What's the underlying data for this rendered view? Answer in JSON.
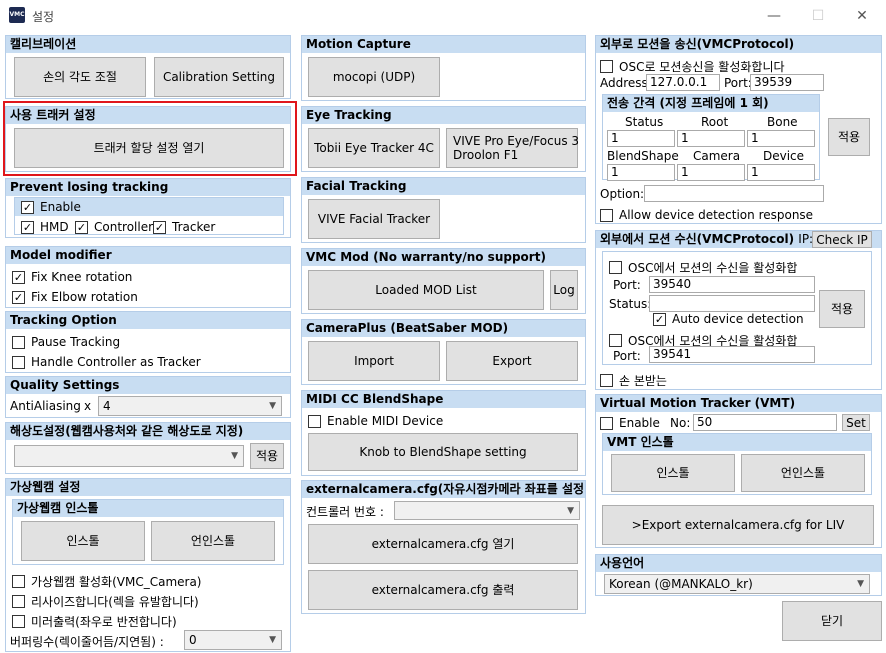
{
  "window": {
    "title": "설정",
    "icon_text": "VMC"
  },
  "calib": {
    "title": "캘리브레이션",
    "hand_btn": "손의 각도 조절",
    "calib_btn": "Calibration Setting"
  },
  "tracker": {
    "title": "사용 트래커 설정",
    "open_btn": "트래커 할당 설정 열기"
  },
  "prevent": {
    "title": "Prevent losing tracking",
    "enable": "Enable",
    "hmd": "HMD",
    "controller": "Controller",
    "tracker": "Tracker"
  },
  "model": {
    "title": "Model modifier",
    "knee": "Fix Knee rotation",
    "elbow": "Fix Elbow rotation"
  },
  "tracking_option": {
    "title": "Tracking Option",
    "pause": "Pause Tracking",
    "handle": "Handle Controller as Tracker"
  },
  "quality": {
    "title": "Quality Settings",
    "aa_label": "AntiAliasing",
    "x": "x",
    "aa_value": "4"
  },
  "resolution": {
    "title": "해상도설정(웹캠사용처와 같은 해상도로 지정)",
    "apply": "적용"
  },
  "vcam": {
    "title": "가상웹캠 설정",
    "install_title": "가상웹캠 인스톨",
    "install": "인스톨",
    "uninstall": "언인스톨",
    "enable": "가상웹캠 활성화(VMC_Camera)",
    "resize": "리사이즈합니다(렉을 유발합니다)",
    "mirror": "미러출력(좌우로 반전합니다)",
    "buffer_label": "버퍼링수(렉이줄어듬/지연됨) :",
    "buffer_value": "0"
  },
  "mocap": {
    "title": "Motion Capture",
    "mocopi": "mocopi (UDP)"
  },
  "eye": {
    "title": "Eye Tracking",
    "tobii": "Tobii Eye Tracker 4C",
    "vive_line1": "VIVE Pro Eye/Focus 3",
    "vive_line2": "Droolon F1"
  },
  "facial": {
    "title": "Facial Tracking",
    "vive": "VIVE Facial Tracker"
  },
  "vmcmod": {
    "title": "VMC Mod (No warranty/no support)",
    "loaded": "Loaded MOD List",
    "log": "Log"
  },
  "cameraplus": {
    "title": "CameraPlus (BeatSaber MOD)",
    "import": "Import",
    "export": "Export"
  },
  "midi": {
    "title": "MIDI CC BlendShape",
    "enable": "Enable MIDI Device",
    "knob": "Knob to BlendShape setting"
  },
  "extcam": {
    "title": "externalcamera.cfg(자유시점카메라 좌표를 설정)",
    "controller_label": "컨트롤러 번호 :",
    "open": "externalcamera.cfg 열기",
    "output": "externalcamera.cfg 출력"
  },
  "send": {
    "title": "외부로 모션을 송신(VMCProtocol)",
    "osc_enable": "OSC로 모션송신을 활성화합니다",
    "address_label": "Address:",
    "address": "127.0.0.1",
    "port_label": "Port:",
    "port": "39539",
    "interval_title": "전송 간격 (지정 프레임에 1 회)",
    "status": "Status",
    "root": "Root",
    "bone": "Bone",
    "status_v": "1",
    "root_v": "1",
    "bone_v": "1",
    "blendshape": "BlendShape",
    "camera": "Camera",
    "device": "Device",
    "blend_v": "1",
    "camera_v": "1",
    "device_v": "1",
    "apply": "적용",
    "option_label": "Option:",
    "allow": "Allow device detection response"
  },
  "receive": {
    "title": "외부에서 모션 수신(VMCProtocol)",
    "ip_label": "IP:",
    "check_ip": "Check IP",
    "osc1": "OSC에서 모션의 수신을 활성화합",
    "port_label": "Port:",
    "port1": "39540",
    "status_label": "Status:",
    "auto": "Auto device detection",
    "apply": "적용",
    "osc2": "OSC에서 모션의 수신을 활성화합",
    "port2": "39541",
    "hand": "손 본받는"
  },
  "vmt": {
    "title": "Virtual Motion Tracker (VMT)",
    "enable": "Enable",
    "no_label": "No:",
    "no_value": "50",
    "set": "Set",
    "install_title": "VMT 인스톨",
    "install": "인스톨",
    "uninstall": "언인스톨",
    "export": ">Export externalcamera.cfg for LIV"
  },
  "lang": {
    "title": "사용언어",
    "value": "Korean (@MANKALO_kr)"
  },
  "close": "닫기"
}
